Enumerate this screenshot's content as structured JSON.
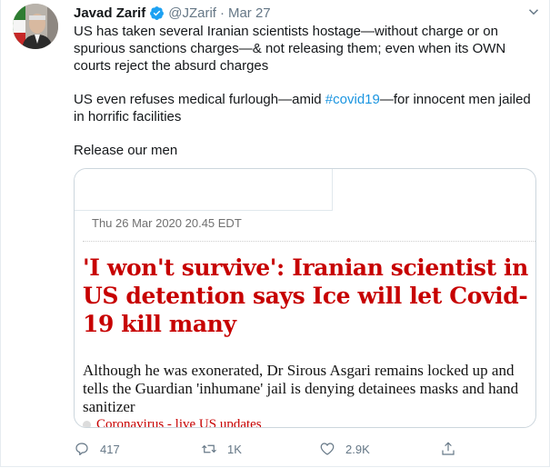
{
  "tweet": {
    "author_name": "Javad Zarif",
    "handle": "@JZarif",
    "separator": "·",
    "date": "Mar 27",
    "text": {
      "p1": "US has taken several Iranian scientists hostage—without charge or on spurious sanctions charges—& not releasing them; even when its OWN courts reject the absurd charges",
      "p2_before": "US even refuses medical furlough—amid ",
      "p2_hashtag": "#covid19",
      "p2_after": "—for innocent men jailed in horrific facilities",
      "p3": "Release our men"
    },
    "card": {
      "dateline": "Thu 26 Mar 2020 20.45 EDT",
      "headline": "'I won't survive': Iranian scientist in US detention says Ice will let Covid-19 kill many",
      "standfirst": "Although he was exonerated, Dr Sirous Asgari remains locked up and tells the Guardian 'inhumane' jail is denying detainees masks and hand sanitizer",
      "related_link": "Coronavirus - live US updates"
    },
    "actions": {
      "reply_count": "417",
      "retweet_count": "1K",
      "like_count": "2.9K"
    }
  },
  "colors": {
    "link": "#1b95e0",
    "verified": "#1da1f2",
    "headline_red": "#c70000",
    "muted": "#657786"
  },
  "icons": [
    "verified-badge-icon",
    "chevron-down-icon",
    "reply-icon",
    "retweet-icon",
    "like-icon",
    "share-icon"
  ]
}
